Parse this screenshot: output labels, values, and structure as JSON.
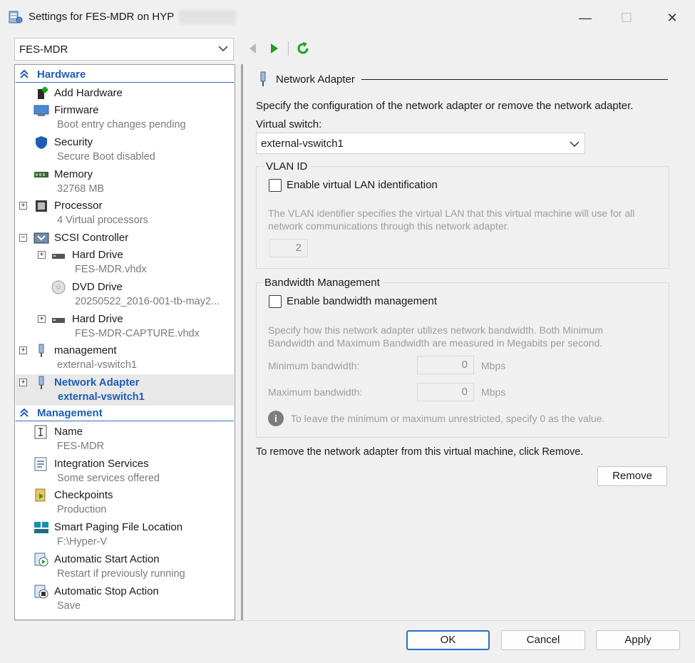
{
  "window": {
    "title": "Settings for FES-MDR on HYP",
    "minimize": "—",
    "maximize": "☐",
    "close": "✕"
  },
  "vm_selector": {
    "value": "FES-MDR"
  },
  "tree": {
    "hardware_label": "Hardware",
    "management_label": "Management",
    "hardware": [
      {
        "name": "Add Hardware",
        "sub": ""
      },
      {
        "name": "Firmware",
        "sub": "Boot entry changes pending"
      },
      {
        "name": "Security",
        "sub": "Secure Boot disabled"
      },
      {
        "name": "Memory",
        "sub": "32768 MB"
      },
      {
        "name": "Processor",
        "sub": "4 Virtual processors"
      },
      {
        "name": "SCSI Controller",
        "sub": ""
      },
      {
        "name": "Hard Drive",
        "sub": "FES-MDR.vhdx"
      },
      {
        "name": "DVD Drive",
        "sub": "20250522_2016-001-tb-may2..."
      },
      {
        "name": "Hard Drive",
        "sub": "FES-MDR-CAPTURE.vhdx"
      },
      {
        "name": "management",
        "sub": "external-vswitch1"
      },
      {
        "name": "Network Adapter",
        "sub": "external-vswitch1"
      }
    ],
    "management": [
      {
        "name": "Name",
        "sub": "FES-MDR"
      },
      {
        "name": "Integration Services",
        "sub": "Some services offered"
      },
      {
        "name": "Checkpoints",
        "sub": "Production"
      },
      {
        "name": "Smart Paging File Location",
        "sub": "F:\\Hyper-V"
      },
      {
        "name": "Automatic Start Action",
        "sub": "Restart if previously running"
      },
      {
        "name": "Automatic Stop Action",
        "sub": "Save"
      }
    ]
  },
  "panel": {
    "header": "Network Adapter",
    "description": "Specify the configuration of the network adapter or remove the network adapter.",
    "virtual_switch_label": "Virtual switch:",
    "virtual_switch_value": "external-vswitch1",
    "vlan": {
      "title": "VLAN ID",
      "checkbox_label": "Enable virtual LAN identification",
      "help_line1": "The VLAN identifier specifies the virtual LAN that this virtual machine will use for all",
      "help_line2": "network communications through this network adapter.",
      "value": "2"
    },
    "bandwidth": {
      "title": "Bandwidth Management",
      "checkbox_label": "Enable bandwidth management",
      "help_line1": "Specify how this network adapter utilizes network bandwidth. Both Minimum",
      "help_line2": "Bandwidth and Maximum Bandwidth are measured in Megabits per second.",
      "min_label": "Minimum bandwidth:",
      "min_value": "0",
      "max_label": "Maximum bandwidth:",
      "max_value": "0",
      "unit": "Mbps",
      "info_text": "To leave the minimum or maximum unrestricted, specify 0 as the value."
    },
    "remove_text": "To remove the network adapter from this virtual machine, click Remove.",
    "remove_button": "Remove"
  },
  "footer": {
    "ok": "OK",
    "cancel": "Cancel",
    "apply": "Apply"
  },
  "colors": {
    "accent": "#1f5db5",
    "nav_green": "#1aa31a"
  }
}
